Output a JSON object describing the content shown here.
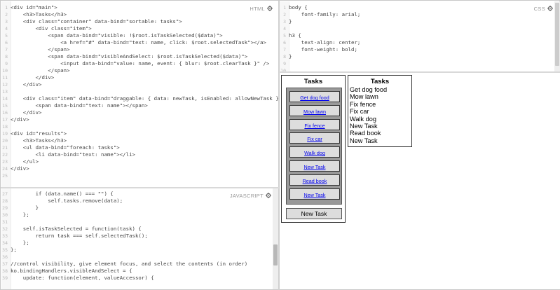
{
  "labels": {
    "html": "HTML",
    "css": "CSS",
    "javascript": "JAVASCRIPT"
  },
  "icons": {
    "gear": "gear-icon"
  },
  "html_code": [
    {
      "n": "1",
      "t": "<div id=\"main\">"
    },
    {
      "n": "2",
      "t": "    <h3>Tasks</h3>"
    },
    {
      "n": "3",
      "t": "    <div class=\"container\" data-bind=\"sortable: tasks\">"
    },
    {
      "n": "4",
      "t": "        <div class=\"item\">"
    },
    {
      "n": "5",
      "t": "            <span data-bind=\"visible: !$root.isTaskSelected($data)\">"
    },
    {
      "n": "6",
      "t": "                <a href=\"#\" data-bind=\"text: name, click: $root.selectedTask\"></a>"
    },
    {
      "n": "7",
      "t": "            </span>"
    },
    {
      "n": "8",
      "t": "            <span data-bind=\"visibleAndSelect: $root.isTaskSelected($data)\">"
    },
    {
      "n": "9",
      "t": "                <input data-bind=\"value: name, event: { blur: $root.clearTask }\" />"
    },
    {
      "n": "10",
      "t": "            </span>"
    },
    {
      "n": "11",
      "t": "        </div>"
    },
    {
      "n": "12",
      "t": "    </div>"
    },
    {
      "n": "13",
      "t": ""
    },
    {
      "n": "14",
      "t": "    <div class=\"item\" data-bind=\"draggable: { data: newTask, isEnabled: allowNewTask }\">"
    },
    {
      "n": "15",
      "t": "        <span data-bind=\"text: name\"></span>"
    },
    {
      "n": "16",
      "t": "    </div>"
    },
    {
      "n": "17",
      "t": "</div>"
    },
    {
      "n": "18",
      "t": ""
    },
    {
      "n": "19",
      "t": "<div id=\"results\">"
    },
    {
      "n": "20",
      "t": "    <h3>Tasks</h3>"
    },
    {
      "n": "21",
      "t": "    <ul data-bind=\"foreach: tasks\">"
    },
    {
      "n": "22",
      "t": "        <li data-bind=\"text: name\"></li>"
    },
    {
      "n": "23",
      "t": "    </ul>"
    },
    {
      "n": "24",
      "t": "</div>"
    },
    {
      "n": "25",
      "t": ""
    }
  ],
  "css_code": [
    {
      "n": "1",
      "t": "body {"
    },
    {
      "n": "2",
      "t": "    font-family: arial;"
    },
    {
      "n": "3",
      "t": "}"
    },
    {
      "n": "4",
      "t": ""
    },
    {
      "n": "5",
      "t": "h3 {"
    },
    {
      "n": "6",
      "t": "    text-align: center;"
    },
    {
      "n": "7",
      "t": "    font-weight: bold;"
    },
    {
      "n": "8",
      "t": "}"
    },
    {
      "n": "9",
      "t": ""
    },
    {
      "n": "10",
      "t": "."
    }
  ],
  "js_code": [
    {
      "n": "27",
      "t": "        if (data.name() === \"\") {"
    },
    {
      "n": "28",
      "t": "            self.tasks.remove(data);"
    },
    {
      "n": "29",
      "t": "        }"
    },
    {
      "n": "30",
      "t": "    };"
    },
    {
      "n": "31",
      "t": ""
    },
    {
      "n": "32",
      "t": "    self.isTaskSelected = function(task) {"
    },
    {
      "n": "33",
      "t": "        return task === self.selectedTask();"
    },
    {
      "n": "34",
      "t": "    };"
    },
    {
      "n": "35",
      "t": "};"
    },
    {
      "n": "36",
      "t": ""
    },
    {
      "n": "37",
      "t": "//control visibility, give element focus, and select the contents (in order)"
    },
    {
      "n": "38",
      "t": "ko.bindingHandlers.visibleAndSelect = {"
    },
    {
      "n": "39",
      "t": "    update: function(element, valueAccessor) {"
    }
  ],
  "result": {
    "main_title": "Tasks",
    "results_title": "Tasks",
    "tasks": [
      "Get dog food",
      "Mow lawn",
      "Fix fence",
      "Fix car",
      "Walk dog",
      "New Task",
      "Read book",
      "New Task"
    ],
    "new_task_label": "New Task"
  }
}
